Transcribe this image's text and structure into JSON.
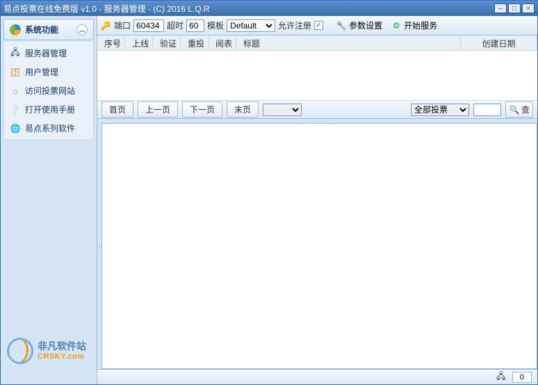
{
  "title": "易点投票在线免费版 v1.0 - 服务器管理 - (C) 2016 L.Q.R",
  "sidebar": {
    "header": "系统功能",
    "items": [
      {
        "label": "服务器管理",
        "icon": "server-icon"
      },
      {
        "label": "用户管理",
        "icon": "database-icon"
      },
      {
        "label": "访问投票网站",
        "icon": "home-icon"
      },
      {
        "label": "打开使用手册",
        "icon": "help-icon"
      },
      {
        "label": "易点系列软件",
        "icon": "globe-icon"
      }
    ]
  },
  "toolbar": {
    "port_label": "端口",
    "port_value": "60434",
    "timeout_label": "超时",
    "timeout_value": "60",
    "template_label": "模板",
    "template_value": "Default",
    "allow_reg_label": "允许注册",
    "allow_reg_checked": true,
    "param_label": "参数设置",
    "start_label": "开始服务"
  },
  "columns": [
    "序号",
    "上线",
    "验证",
    "重投",
    "阅表",
    "标题",
    "创建日期"
  ],
  "pager": {
    "first": "首页",
    "prev": "上一页",
    "next": "下一页",
    "last": "末页",
    "page_value": "",
    "filter_value": "全部投票",
    "search_value": "",
    "search_btn": "查"
  },
  "status": {
    "count": "0"
  },
  "watermark": {
    "cn": "非凡软件站",
    "en": "CRSKY.com"
  }
}
